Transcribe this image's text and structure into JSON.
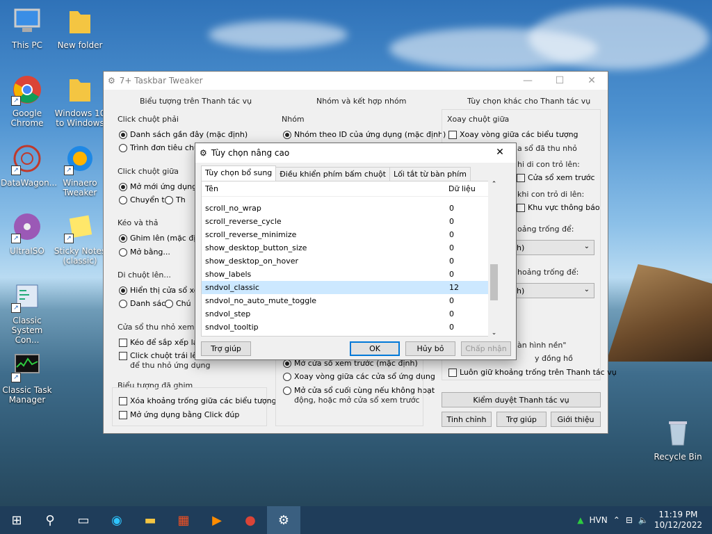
{
  "desktop": {
    "icons": [
      {
        "label": "This PC",
        "icon": "computer-icon"
      },
      {
        "label": "New folder",
        "icon": "folder-icon"
      },
      {
        "label": "Google Chrome",
        "icon": "chrome-icon"
      },
      {
        "label": "Windows 10 to Windows",
        "icon": "folder-icon"
      },
      {
        "label": "DataWagon...",
        "icon": "datawagon-icon"
      },
      {
        "label": "Winaero Tweaker",
        "icon": "winaero-icon"
      },
      {
        "label": "UltraISO",
        "icon": "disc-icon"
      },
      {
        "label": "Sticky Notes (classic)",
        "icon": "sticky-notes-icon"
      },
      {
        "label": "Classic System Con...",
        "icon": "control-panel-icon"
      },
      {
        "label": "Classic Task Manager",
        "icon": "task-manager-icon"
      },
      {
        "label": "Recycle Bin",
        "icon": "recycle-bin-icon"
      }
    ]
  },
  "main_window": {
    "title": "7+ Taskbar Tweaker",
    "col1": {
      "title": "Biểu tượng trên Thanh tác vụ",
      "right_click": "Click chuột phải",
      "rc_opt1": "Danh sách gần đây (mặc định)",
      "rc_opt2": "Trình đơn tiêu chuẩ",
      "middle_click": "Click chuột giữa",
      "mc_opt1": "Mở mới ứng dụng (n",
      "mc_opt2": "Chuyển tới",
      "mc_opt3": "Th",
      "drag": "Kéo và thả",
      "drag_opt1": "Ghim lên (mặc định)",
      "drag_opt2": "Mở bằng...",
      "hover": "Di chuột lên...",
      "hover_opt1": "Hiển thị cửa sổ xem",
      "hover_opt2": "Danh sách",
      "hover_opt3": "Chú",
      "thumb": "Cửa sổ thu nhỏ xem tr",
      "thumb_opt1": "Kéo để sắp xếp lại",
      "thumb_opt2": "Click chuột trái lên c",
      "thumb_opt2b": "để thu nhỏ ứng dụng",
      "pinned": "Biểu tượng đã ghim",
      "pinned_opt1": "Xóa khoảng trống giữa các biểu tượng",
      "pinned_opt2": "Mở ứng dụng bằng Click đúp"
    },
    "col2": {
      "title": "Nhóm và kết hợp nhóm",
      "group": "Nhóm",
      "group_opt1": "Nhóm theo ID của ứng dụng (mặc định)",
      "bot_opt1": "Mở cửa sổ xem trước (mặc định)",
      "bot_opt2": "Xoay vòng giữa các cửa sổ ứng dụng",
      "bot_opt3": "Mở cửa sổ cuối cùng nếu không hoạt",
      "bot_opt3b": "động, hoặc mở cửa sổ xem trước"
    },
    "col3": {
      "title": "Tùy chọn khác cho Thanh tác vụ",
      "wheel": "Xoay chuột giữa",
      "wheel_opt1": "Xoay vòng giữa các biểu tượng",
      "frag1": "a sổ đã thu nhỏ",
      "frag2": "hi di con trỏ lên:",
      "frag3": "Cửa sổ xem trước",
      "frag4": "khi con trỏ di lên:",
      "frag5": "Khu vực thông báo",
      "frag6": "oảng trống để:",
      "sel1": "nh)",
      "frag7": "hoảng trống để:",
      "sel2": "nh)",
      "frag8": "àn hình nền\"",
      "frag9": "y đồng hồ",
      "keep_space": "Luôn giữ khoảng trống trên Thanh tác vụ",
      "inspect_btn": "Kiểm duyệt Thanh tác vụ",
      "tinh_chinh": "Tinh chỉnh",
      "tro_giup": "Trợ giúp",
      "gioi_thieu": "Giới thiệu"
    }
  },
  "dialog": {
    "title": "Tùy chọn nâng cao",
    "tabs": [
      "Tùy chọn bổ sung",
      "Điều khiển phím bấm chuột",
      "Lối tắt từ bàn phím"
    ],
    "col_name": "Tên",
    "col_value": "Dữ liệu",
    "rows": [
      {
        "name": "scroll_no_wrap",
        "value": "0"
      },
      {
        "name": "scroll_reverse_cycle",
        "value": "0"
      },
      {
        "name": "scroll_reverse_minimize",
        "value": "0"
      },
      {
        "name": "show_desktop_button_size",
        "value": "0"
      },
      {
        "name": "show_desktop_on_hover",
        "value": "0"
      },
      {
        "name": "show_labels",
        "value": "0"
      },
      {
        "name": "sndvol_classic",
        "value": "12"
      },
      {
        "name": "sndvol_no_auto_mute_toggle",
        "value": "0"
      },
      {
        "name": "sndvol_step",
        "value": "0"
      },
      {
        "name": "sndvol_tooltip",
        "value": "0"
      }
    ],
    "selected_row": "sndvol_classic",
    "help": "Trợ giúp",
    "ok": "OK",
    "cancel": "Hủy bỏ",
    "apply": "Chấp nhận"
  },
  "taskbar": {
    "network": "HVN",
    "time": "11:19 PM",
    "date": "10/12/2022"
  }
}
